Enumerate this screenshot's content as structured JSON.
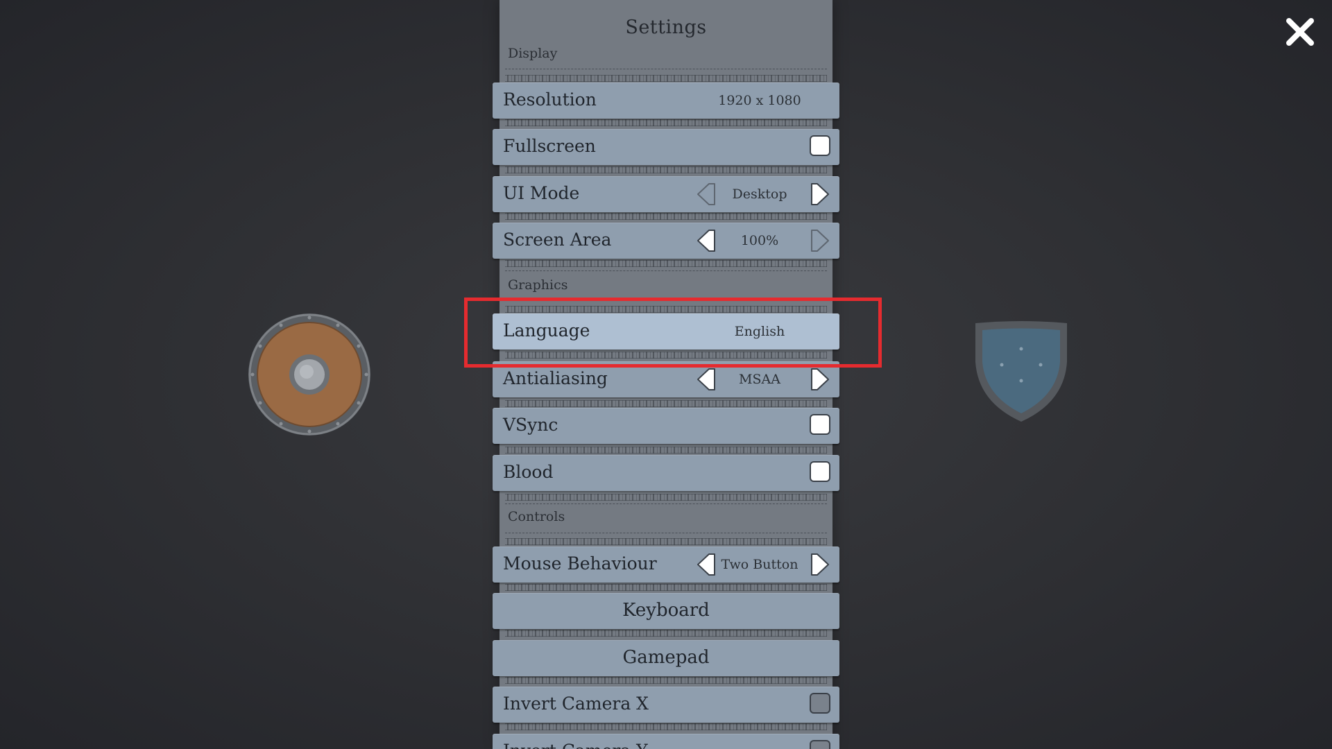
{
  "panel": {
    "title": "Settings",
    "sections": {
      "display": "Display",
      "graphics": "Graphics",
      "controls": "Controls"
    }
  },
  "rows": {
    "resolution": {
      "label": "Resolution",
      "value": "1920 x 1080"
    },
    "fullscreen": {
      "label": "Fullscreen",
      "checked": false
    },
    "ui_mode": {
      "label": "UI Mode",
      "value": "Desktop"
    },
    "screen_area": {
      "label": "Screen Area",
      "value": "100%"
    },
    "language": {
      "label": "Language",
      "value": "English"
    },
    "antialiasing": {
      "label": "Antialiasing",
      "value": "MSAA"
    },
    "vsync": {
      "label": "VSync",
      "checked": false
    },
    "blood": {
      "label": "Blood",
      "checked": false
    },
    "mouse_behaviour": {
      "label": "Mouse Behaviour",
      "value": "Two Button"
    },
    "keyboard": {
      "label": "Keyboard"
    },
    "gamepad": {
      "label": "Gamepad"
    },
    "invert_camera_x": {
      "label": "Invert Camera X",
      "checked": false
    },
    "invert_camera_y": {
      "label": "Invert Camera Y",
      "checked": false
    }
  },
  "icons": {
    "close": "close-icon",
    "round_shield": "round-shield-icon",
    "kite_shield": "kite-shield-icon",
    "arrow_left": "arrow-left-icon",
    "arrow_right": "arrow-right-icon"
  },
  "colors": {
    "background": "#2e2f33",
    "panel": "#747a82",
    "row": "#8f9eae",
    "row_selected": "#aebfd2",
    "highlight": "#e52b2f",
    "round_shield_wood": "#9a6a44",
    "kite_shield": "#4b6a7f"
  }
}
